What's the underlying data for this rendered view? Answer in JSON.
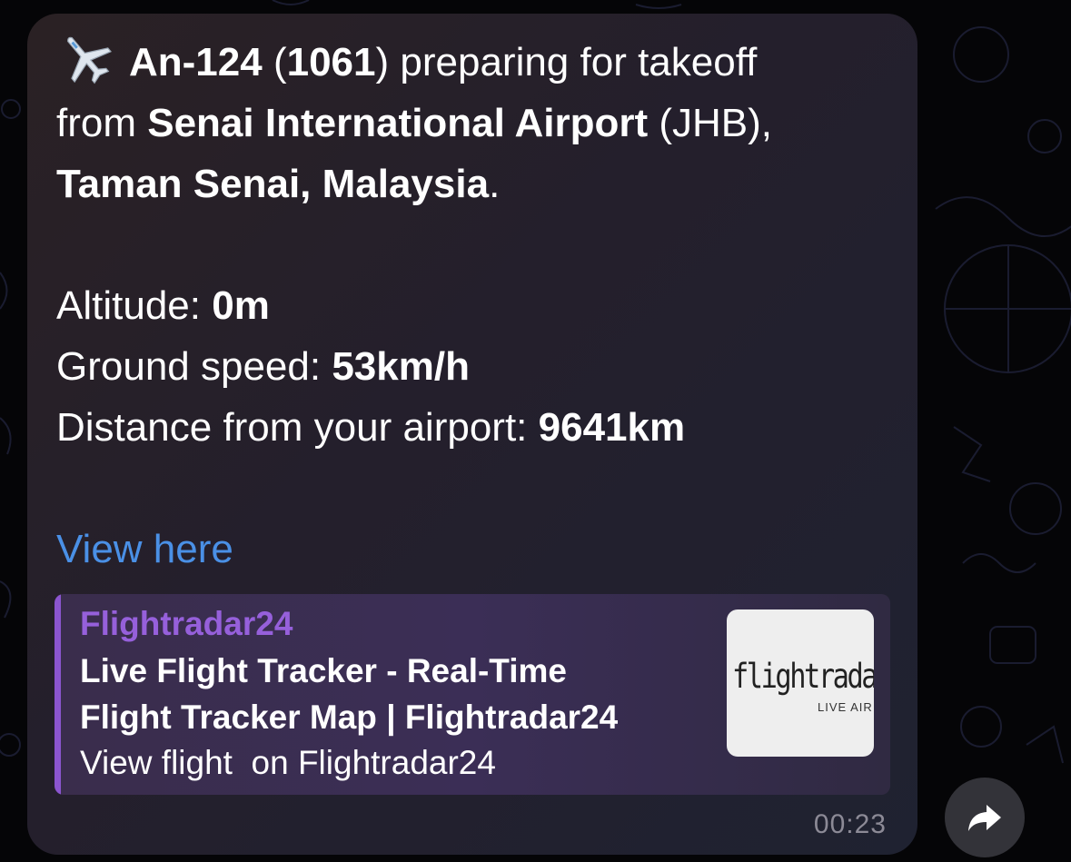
{
  "message": {
    "plane_icon": "airplane-icon",
    "aircraft": "An-124",
    "flight_id_open": " (",
    "flight_id": "1061",
    "status_suffix": ") preparing for takeoff",
    "from_prefix": "from ",
    "airport": "Senai International Airport",
    "airport_code": " (JHB),",
    "location": "Taman Senai, Malaysia",
    "location_end": ".",
    "altitude_label": "Altitude: ",
    "altitude_value": "0m",
    "speed_label": "Ground speed: ",
    "speed_value": "53km/h",
    "distance_label": "Distance from your airport: ",
    "distance_value": "9641km",
    "link_text": "View here"
  },
  "preview": {
    "site_name": "Flightradar24",
    "title_line1": "Live Flight Tracker - Real-Time",
    "title_line2": "Flight Tracker Map | Flightradar24",
    "description": "View flight  on Flightradar24",
    "thumb_logo": "flightradar",
    "thumb_tagline": "LIVE AIR T",
    "accent_color": "#8b55cf"
  },
  "timestamp": "00:23",
  "share_icon": "forward-arrow-icon"
}
